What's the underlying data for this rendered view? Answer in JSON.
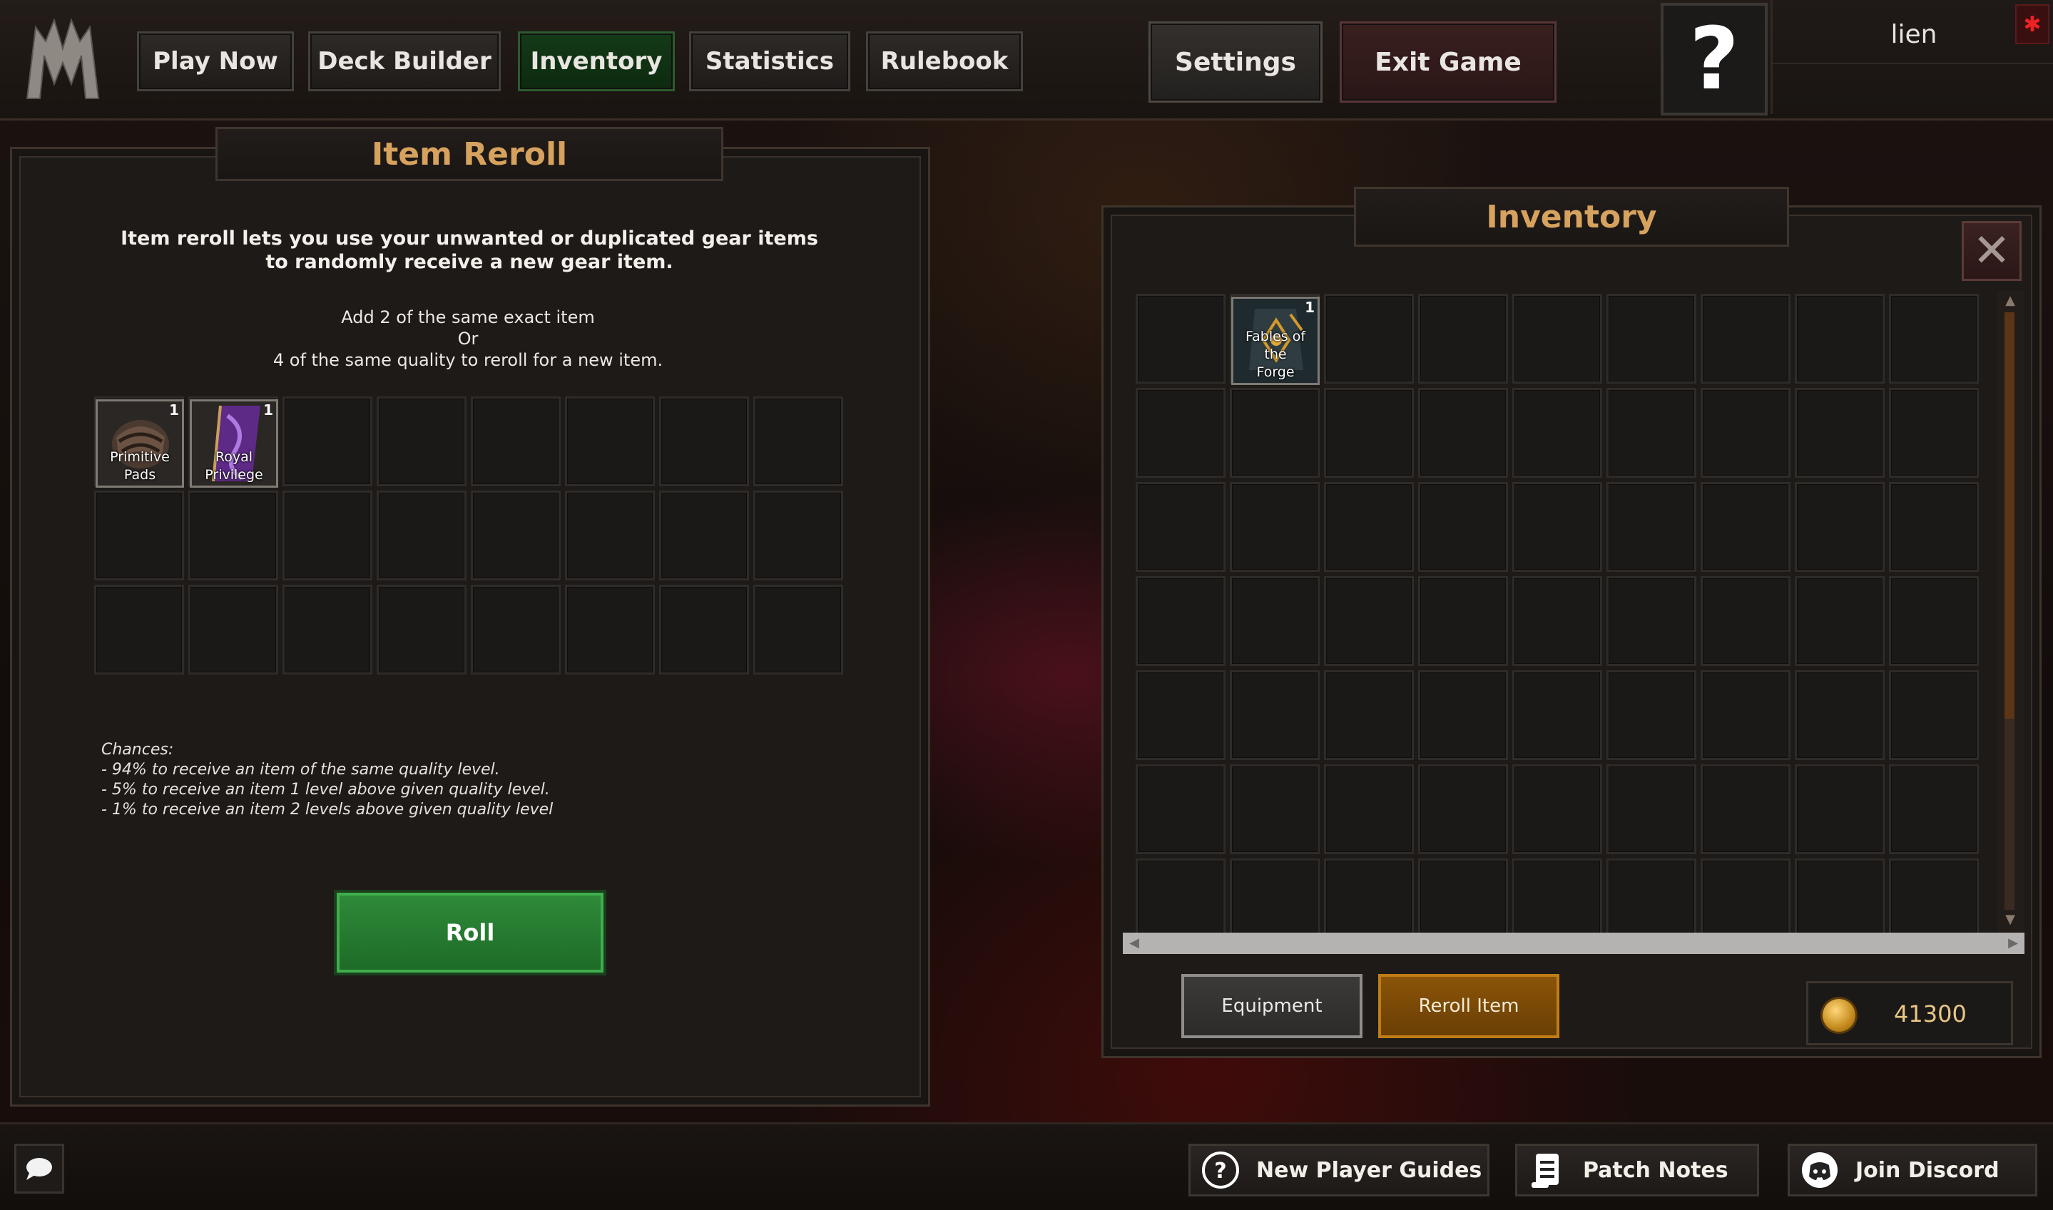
{
  "topnav": {
    "play_now": "Play Now",
    "deck_builder": "Deck Builder",
    "inventory": "Inventory",
    "statistics": "Statistics",
    "rulebook": "Rulebook",
    "settings": "Settings",
    "exit_game": "Exit Game",
    "help": "?"
  },
  "user": {
    "name": "lien"
  },
  "reroll_panel": {
    "title": "Item Reroll",
    "intro_line1": "Item reroll lets you use your unwanted or duplicated gear items",
    "intro_line2": "to randomly receive a new gear item.",
    "rule_line1": "Add 2 of the same exact item",
    "rule_line2": "Or",
    "rule_line3": "4 of the same quality to reroll for a new item.",
    "slots": [
      {
        "name_line1": "Primitive",
        "name_line2": "Pads",
        "count": "1"
      },
      {
        "name_line1": "Royal",
        "name_line2": "Privilege",
        "count": "1"
      }
    ],
    "chances_title": "Chances:",
    "chance1": "- 94% to receive an item of the  same quality level.",
    "chance2": "- 5% to receive an item 1 level above given quality level.",
    "chance3": "- 1%  to receive an item 2 levels above given quality level",
    "roll_label": "Roll"
  },
  "inventory_panel": {
    "title": "Inventory",
    "close": "✕",
    "items": [
      {
        "name_line1": "Fables of the",
        "name_line2": "Forge",
        "count": "1"
      }
    ],
    "equipment_tab": "Equipment",
    "reroll_tab": "Reroll Item",
    "gold": "41300"
  },
  "footer": {
    "guides": "New Player Guides",
    "patch_notes": "Patch Notes",
    "discord": "Join Discord"
  },
  "colors": {
    "accent_gold": "#d6a25e",
    "active_green": "#143a17",
    "roll_green": "#2f8b3a",
    "reroll_orange": "#8a5408"
  }
}
